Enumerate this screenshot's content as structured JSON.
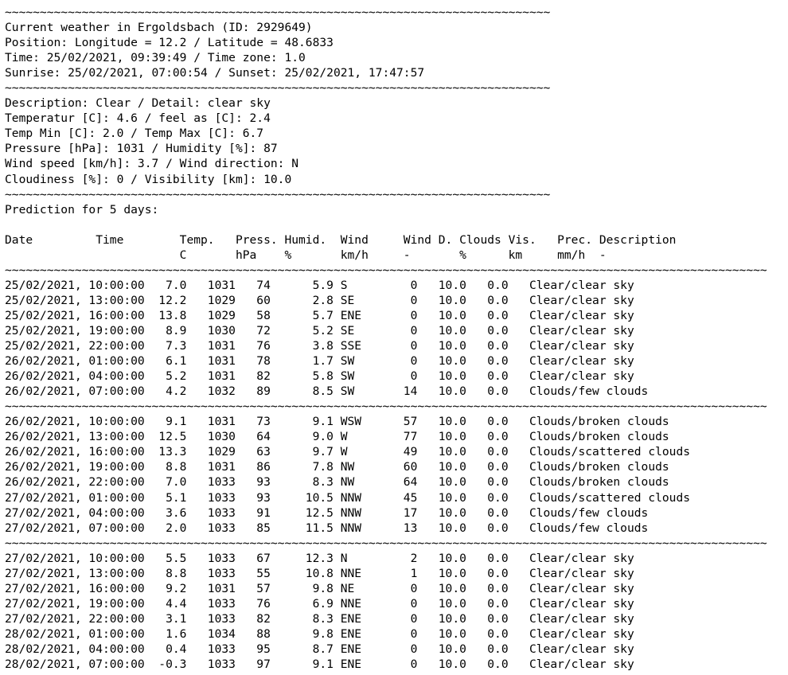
{
  "document": {
    "type": "plain-text-weather-report",
    "background_color": "#ffffff",
    "text_color": "#000000",
    "separator_char": "~"
  },
  "current": {
    "title": "Current weather in Ergoldsbach (ID: 2929649)",
    "city": "Ergoldsbach",
    "city_id": "2929649",
    "position_line": "Position: Longitude = 12.2 / Latitude = 48.6833",
    "longitude": "12.2",
    "latitude": "48.6833",
    "time_line": "Time: 25/02/2021, 09:39:49 / Time zone: 1.0",
    "time": "25/02/2021, 09:39:49",
    "time_zone": "1.0",
    "sun_line": "Sunrise: 25/02/2021, 07:00:54 / Sunset: 25/02/2021, 17:47:57",
    "sunrise": "25/02/2021, 07:00:54",
    "sunset": "25/02/2021, 17:47:57",
    "description_line": "Description: Clear / Detail: clear sky",
    "description": "Clear",
    "detail": "clear sky",
    "temperature_line": "Temperatur [C]: 4.6 / feel as [C]: 2.4",
    "temperature_c": "4.6",
    "feels_like_c": "2.4",
    "temp_minmax_line": "Temp Min [C]: 2.0 / Temp Max [C]: 6.7",
    "temp_min_c": "2.0",
    "temp_max_c": "6.7",
    "pressure_humidity_line": "Pressure [hPa]: 1031 / Humidity [%]: 87",
    "pressure_hpa": "1031",
    "humidity_pct": "87",
    "wind_line": "Wind speed [km/h]: 3.7 / Wind direction: N",
    "wind_speed_kmh": "3.7",
    "wind_direction": "N",
    "clouds_visibility_line": "Cloudiness [%]: 0 / Visibility [km]: 10.0",
    "cloudiness_pct": "0",
    "visibility_km": "10.0"
  },
  "forecast": {
    "heading": "Prediction for 5 days:",
    "header_row_1": "Date         Time        Temp.   Press. Humid.  Wind     Wind D. Clouds Vis.   Prec. Description",
    "header_row_2": "                         C       hPa    %       km/h     -       %      km     mm/h  -",
    "columns": [
      {
        "label": "Date",
        "unit": ""
      },
      {
        "label": "Time",
        "unit": ""
      },
      {
        "label": "Temp.",
        "unit": "C"
      },
      {
        "label": "Press.",
        "unit": "hPa"
      },
      {
        "label": "Humid.",
        "unit": "%"
      },
      {
        "label": "Wind",
        "unit": "km/h"
      },
      {
        "label": "Wind D.",
        "unit": "-"
      },
      {
        "label": "Clouds",
        "unit": "%"
      },
      {
        "label": "Vis.",
        "unit": "km"
      },
      {
        "label": "Prec.",
        "unit": "mm/h"
      },
      {
        "label": "Description",
        "unit": "-"
      }
    ],
    "blocks": [
      {
        "rows": [
          "25/02/2021, 10:00:00   7.0   1031   74      5.9 S         0   10.0   0.0   Clear/clear sky",
          "25/02/2021, 13:00:00  12.2   1029   60      2.8 SE        0   10.0   0.0   Clear/clear sky",
          "25/02/2021, 16:00:00  13.8   1029   58      5.7 ENE       0   10.0   0.0   Clear/clear sky",
          "25/02/2021, 19:00:00   8.9   1030   72      5.2 SE        0   10.0   0.0   Clear/clear sky",
          "25/02/2021, 22:00:00   7.3   1031   76      3.8 SSE       0   10.0   0.0   Clear/clear sky",
          "26/02/2021, 01:00:00   6.1   1031   78      1.7 SW        0   10.0   0.0   Clear/clear sky",
          "26/02/2021, 04:00:00   5.2   1031   82      5.8 SW        0   10.0   0.0   Clear/clear sky",
          "26/02/2021, 07:00:00   4.2   1032   89      8.5 SW       14   10.0   0.0   Clouds/few clouds"
        ]
      },
      {
        "rows": [
          "26/02/2021, 10:00:00   9.1   1031   73      9.1 WSW      57   10.0   0.0   Clouds/broken clouds",
          "26/02/2021, 13:00:00  12.5   1030   64      9.0 W        77   10.0   0.0   Clouds/broken clouds",
          "26/02/2021, 16:00:00  13.3   1029   63      9.7 W        49   10.0   0.0   Clouds/scattered clouds",
          "26/02/2021, 19:00:00   8.8   1031   86      7.8 NW       60   10.0   0.0   Clouds/broken clouds",
          "26/02/2021, 22:00:00   7.0   1033   93      8.3 NW       64   10.0   0.0   Clouds/broken clouds",
          "27/02/2021, 01:00:00   5.1   1033   93     10.5 NNW      45   10.0   0.0   Clouds/scattered clouds",
          "27/02/2021, 04:00:00   3.6   1033   91     12.5 NNW      17   10.0   0.0   Clouds/few clouds",
          "27/02/2021, 07:00:00   2.0   1033   85     11.5 NNW      13   10.0   0.0   Clouds/few clouds"
        ]
      },
      {
        "rows": [
          "27/02/2021, 10:00:00   5.5   1033   67     12.3 N         2   10.0   0.0   Clear/clear sky",
          "27/02/2021, 13:00:00   8.8   1033   55     10.8 NNE       1   10.0   0.0   Clear/clear sky",
          "27/02/2021, 16:00:00   9.2   1031   57      9.8 NE        0   10.0   0.0   Clear/clear sky",
          "27/02/2021, 19:00:00   4.4   1033   76      6.9 NNE       0   10.0   0.0   Clear/clear sky",
          "27/02/2021, 22:00:00   3.1   1033   82      8.3 ENE       0   10.0   0.0   Clear/clear sky",
          "28/02/2021, 01:00:00   1.6   1034   88      9.8 ENE       0   10.0   0.0   Clear/clear sky",
          "28/02/2021, 04:00:00   0.4   1033   95      8.7 ENE       0   10.0   0.0   Clear/clear sky",
          "28/02/2021, 07:00:00  -0.3   1033   97      9.1 ENE       0   10.0   0.0   Clear/clear sky"
        ]
      }
    ]
  },
  "separators": {
    "short": "~~~~~~~~~~~~~~~~~~~~~~~~~~~~~~~~~~~~~~~~~~~~~~~~~~~~~~~~~~~~~~~~~~~~~~~~~~~~~~",
    "long": "~~~~~~~~~~~~~~~~~~~~~~~~~~~~~~~~~~~~~~~~~~~~~~~~~~~~~~~~~~~~~~~~~~~~~~~~~~~~~~~~~~~~~~~~~~~~~~~~~~~~~~~~~~~~~"
  }
}
